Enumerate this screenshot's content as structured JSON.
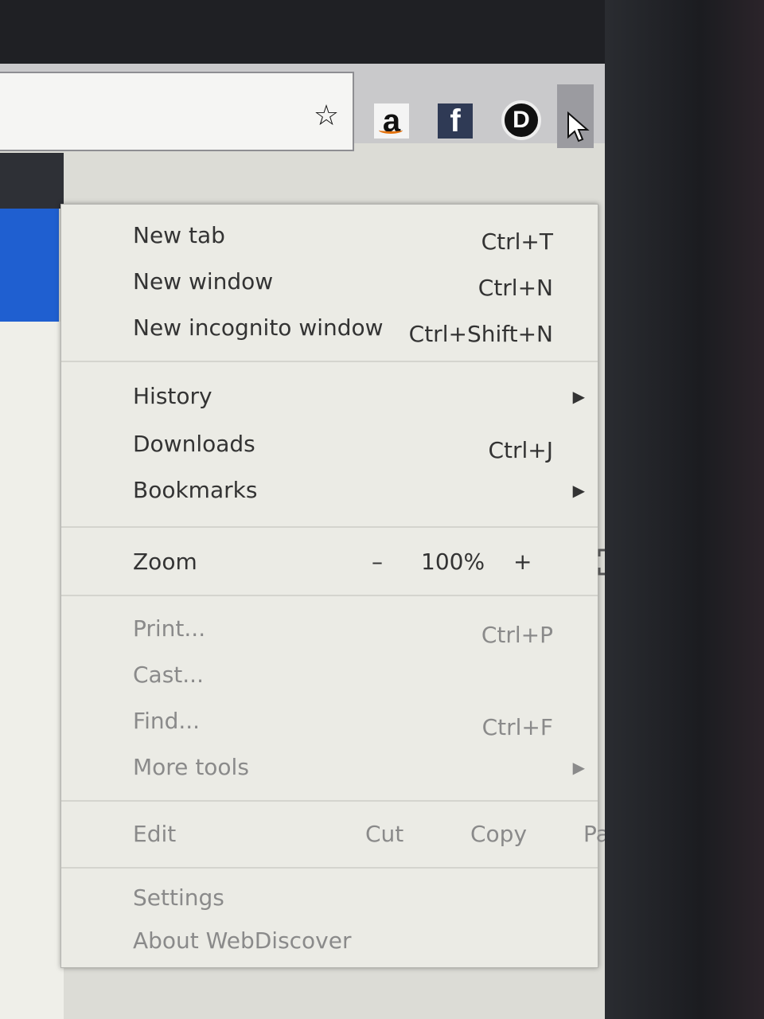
{
  "toolbar": {
    "icons": [
      "bookmark-star-icon",
      "amazon-icon",
      "facebook-icon",
      "d-extension-icon",
      "menu-icon"
    ],
    "amazon_letter": "a",
    "facebook_letter": "f",
    "d_letter": "D"
  },
  "menu": {
    "new_tab": {
      "label": "New tab",
      "shortcut": "Ctrl+T"
    },
    "new_window": {
      "label": "New window",
      "shortcut": "Ctrl+N"
    },
    "new_incognito": {
      "label": "New incognito window",
      "shortcut": "Ctrl+Shift+N"
    },
    "history": {
      "label": "History"
    },
    "downloads": {
      "label": "Downloads",
      "shortcut": "Ctrl+J"
    },
    "bookmarks": {
      "label": "Bookmarks"
    },
    "zoom": {
      "label": "Zoom",
      "minus": "–",
      "value": "100%",
      "plus": "+"
    },
    "print": {
      "label": "Print...",
      "shortcut": "Ctrl+P"
    },
    "cast": {
      "label": "Cast..."
    },
    "find": {
      "label": "Find...",
      "shortcut": "Ctrl+F"
    },
    "more_tools": {
      "label": "More tools"
    },
    "edit": {
      "label": "Edit",
      "cut": "Cut",
      "copy": "Copy",
      "paste": "Paste"
    },
    "settings": {
      "label": "Settings"
    },
    "about": {
      "label": "About WebDiscover"
    }
  },
  "colors": {
    "menu_bg": "#ebebe5",
    "blue_panel": "#1f5fd0",
    "facebook": "#2f3a55"
  }
}
